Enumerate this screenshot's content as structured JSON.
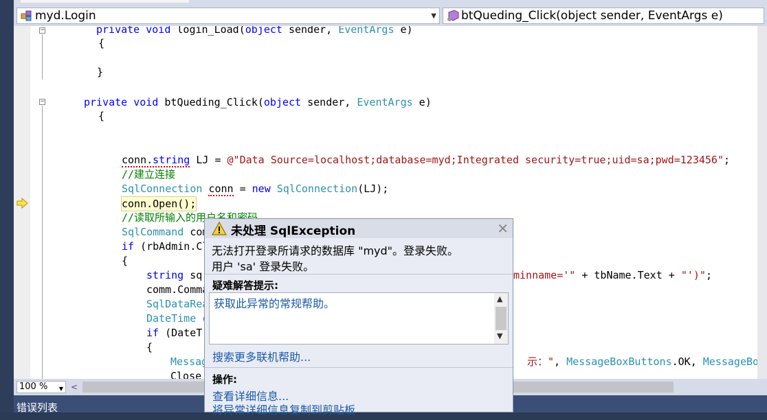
{
  "navbar": {
    "class_combo": "myd.Login",
    "member_combo": "btQueding_Click(object sender, EventArgs e)"
  },
  "code": {
    "line1": {
      "kw": "private void ",
      "name": "login_Load(",
      "kw2": "object",
      "mid": " sender, ",
      "ty": "EventArgs",
      "end": " e)"
    },
    "brace_open": "{",
    "brace_close": "}",
    "line2": {
      "kw": "private void ",
      "name": "btQueding_Click(",
      "kw2": "object",
      "mid": " sender, ",
      "ty": "EventArgs",
      "end": " e)"
    },
    "conn_decl": {
      "a": "conn.",
      "b": "string",
      "c": " LJ = ",
      "str": "@\"Data Source=localhost;database=myd;Integrated security=true;uid=sa;pwd=123456\"",
      "end": ";"
    },
    "comment1": "//建立连接",
    "sqlconn": {
      "ty": "SqlConnection",
      "sp": " ",
      "var": "conn",
      "eq": " = ",
      "kw": "new",
      "sp2": " ",
      "ty2": "SqlConnection",
      "end": "(LJ);"
    },
    "open_line": "conn.Open();",
    "comment2": "//读取所输入的用户名和密码",
    "sqlcmd": {
      "ty": "SqlCommand",
      "rest": " com"
    },
    "if_line": {
      "kw": "if",
      "rest": " (rbAdmin.Cl"
    },
    "brace2": "{",
    "string_sq": {
      "kw": "string",
      "rest": " sq"
    },
    "string_sq_tail": {
      "str": "minname='\"",
      "rest": " + tbName.Text + ",
      "str2": "\"')\"",
      "end": ";"
    },
    "comm_line": "comm.Comma",
    "sqldata": "SqlDataRea",
    "datetime": "DateTime c",
    "if_date": {
      "kw": "if",
      "rest": " (DateT"
    },
    "brace3": "{",
    "msg_line": "Messag",
    "msg_tail": {
      "a": "示：\"",
      "b": ", ",
      "ty": "MessageBoxButtons",
      "c": ".OK, ",
      "ty2": "MessageBoxI"
    },
    "close_line": "Close"
  },
  "zoom": "100 %",
  "error_list": "错误列表",
  "exception": {
    "title": "未处理 SqlException",
    "message_line1": "无法打开登录所请求的数据库 \"myd\"。登录失败。",
    "message_line2": "用户 'sa' 登录失败。",
    "tips_head": "疑难解答提示:",
    "tips_link": "获取此异常的常规帮助。",
    "search_link": "搜索更多联机帮助...",
    "actions_head": "操作:",
    "action1": "查看详细信息...",
    "action2": "将异常详细信息复制到剪贴板"
  }
}
